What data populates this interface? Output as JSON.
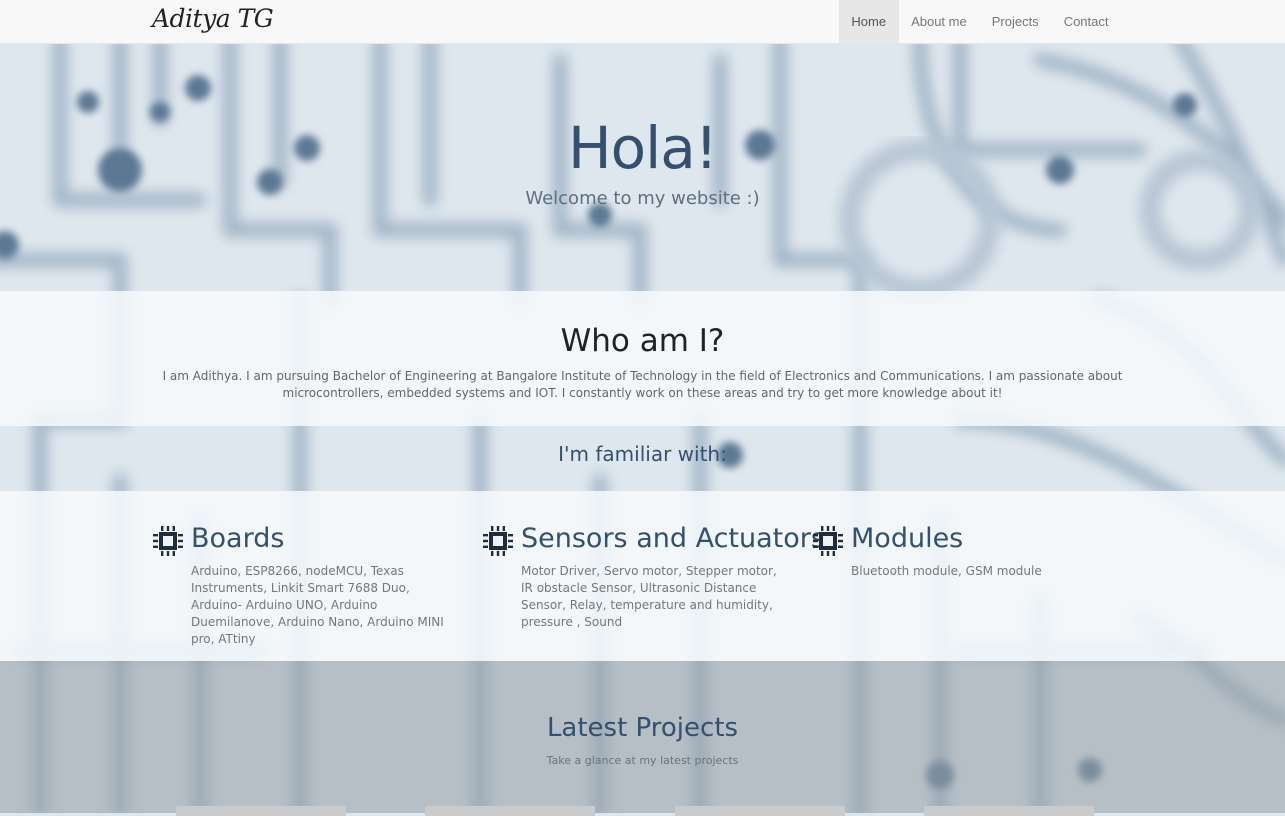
{
  "navbar": {
    "brand": "Aditya TG",
    "links": [
      {
        "label": "Home",
        "active": true
      },
      {
        "label": "About me",
        "active": false
      },
      {
        "label": "Projects",
        "active": false
      },
      {
        "label": "Contact",
        "active": false
      }
    ]
  },
  "hero": {
    "title": "Hola!",
    "subtitle": "Welcome to my website :)"
  },
  "about": {
    "title": "Who am I?",
    "text": "I am Adithya. I am pursuing Bachelor of Engineering at Bangalore Institute of Technology in the field of Electronics and Communications. I am passionate about microcontrollers, embedded systems and IOT. I constantly work on these areas and try to get more knowledge about it!"
  },
  "familiar": {
    "title": "I'm familiar with:"
  },
  "skills": [
    {
      "icon": "chip-icon",
      "title": "Boards",
      "text": "Arduino, ESP8266, nodeMCU, Texas Instruments, Linkit Smart 7688 Duo, Arduino- Arduino UNO, Arduino Duemilanove, Arduino Nano, Arduino MINI pro, ATtiny"
    },
    {
      "icon": "chip-icon",
      "title": "Sensors and Actuators",
      "text": "Motor Driver, Servo motor, Stepper motor, IR obstacle Sensor, Ultrasonic Distance Sensor, Relay, temperature and humidity, pressure , Sound"
    },
    {
      "icon": "chip-icon",
      "title": "Modules",
      "text": "Bluetooth module, GSM module"
    }
  ],
  "latest": {
    "title": "Latest Projects",
    "subtitle": "Take a glance at my latest projects"
  },
  "colors": {
    "accent": "#34506e",
    "nav_bg": "#f8f8f8",
    "nav_active_bg": "#e7e7e7"
  }
}
